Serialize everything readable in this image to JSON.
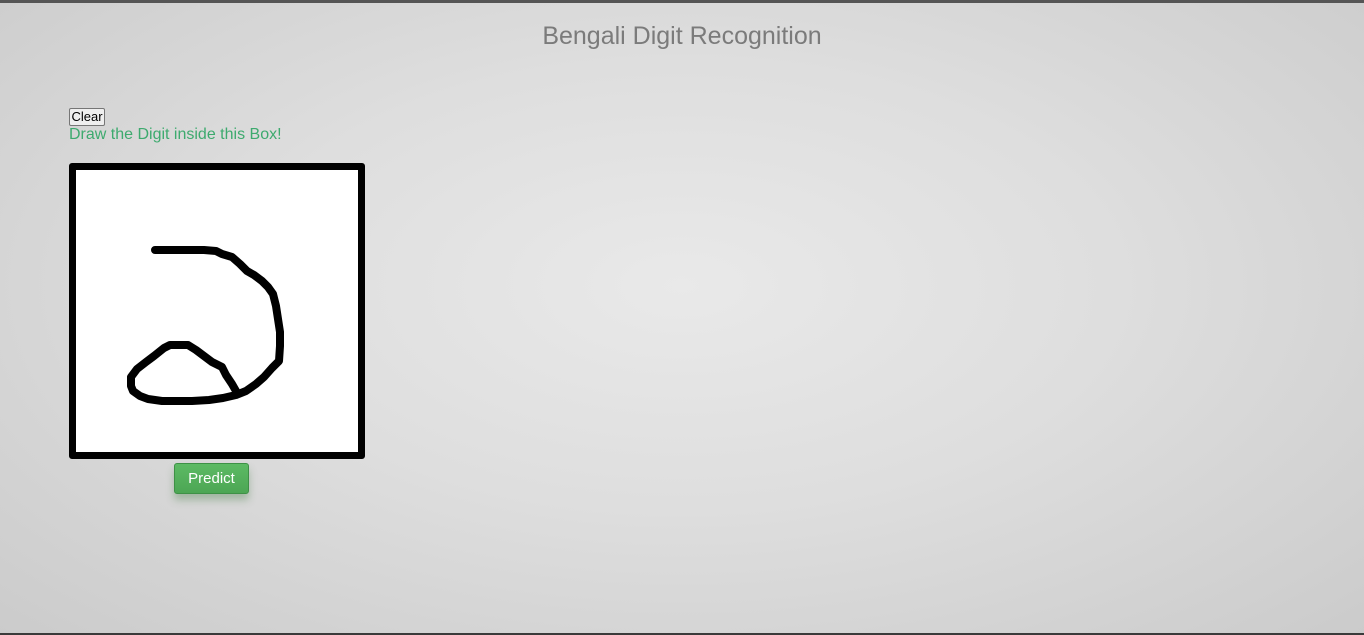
{
  "page": {
    "title": "Bengali Digit Recognition"
  },
  "controls": {
    "clear_label": "Clear",
    "instruction": "Draw the Digit inside this Box!",
    "predict_label": "Predict"
  },
  "colors": {
    "instruction_text": "#3daa6e",
    "predict_button": "#52ac5a",
    "canvas_border": "#000000",
    "title_text": "#7b7b7b"
  }
}
